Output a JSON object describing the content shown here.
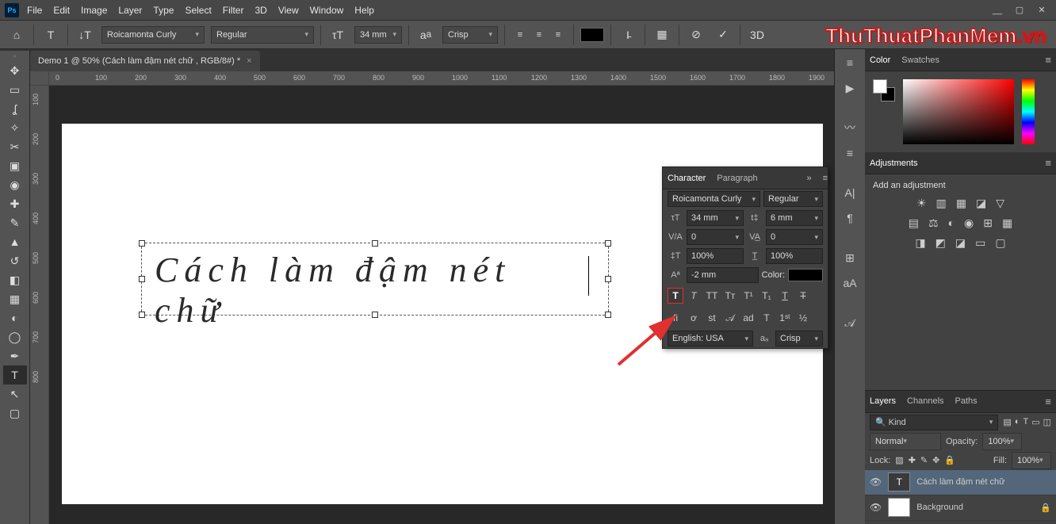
{
  "menu": {
    "items": [
      "File",
      "Edit",
      "Image",
      "Layer",
      "Type",
      "Select",
      "Filter",
      "3D",
      "View",
      "Window",
      "Help"
    ]
  },
  "winctrl": {
    "min": "__",
    "max": "▢",
    "close": "✕"
  },
  "optbar": {
    "font": "Roicamonta Curly",
    "style": "Regular",
    "size": "34 mm",
    "aa": "Crisp",
    "threeD": "3D"
  },
  "docTab": "Demo 1 @ 50% (Cách làm đậm nét chữ , RGB/8#) *",
  "canvasText": "Cách  làm  đậm  nét  chữ",
  "rulerH": [
    "0",
    "100",
    "200",
    "300",
    "400",
    "500",
    "600",
    "700",
    "800",
    "900",
    "1000",
    "1100",
    "1200",
    "1300",
    "1400",
    "1500",
    "1600",
    "1700",
    "1800",
    "1900"
  ],
  "rulerV": [
    "100",
    "200",
    "300",
    "400",
    "500",
    "600",
    "700",
    "800"
  ],
  "rightTabs": {
    "color": "Color",
    "swatches": "Swatches",
    "adjustments": "Adjustments",
    "adjText": "Add an adjustment",
    "layers": "Layers",
    "channels": "Channels",
    "paths": "Paths"
  },
  "char": {
    "tabChar": "Character",
    "tabPara": "Paragraph",
    "font": "Roicamonta Curly",
    "style": "Regular",
    "size": "34 mm",
    "leading": "6 mm",
    "vaL": "0",
    "vaR": "0",
    "hScale": "100%",
    "wScale": "100%",
    "baseline": "-2 mm",
    "colorLabel": "Color:",
    "lang": "English: USA",
    "aa": "Crisp"
  },
  "layers": {
    "search": "Kind",
    "blend": "Normal",
    "opacityL": "Opacity:",
    "opacityV": "100%",
    "lockL": "Lock:",
    "fillL": "Fill:",
    "fillV": "100%",
    "item1": "Cách làm đậm nét chữ",
    "item2": "Background"
  },
  "watermark": {
    "a": "ThuThuatPhanMem",
    "b": ".vn"
  }
}
